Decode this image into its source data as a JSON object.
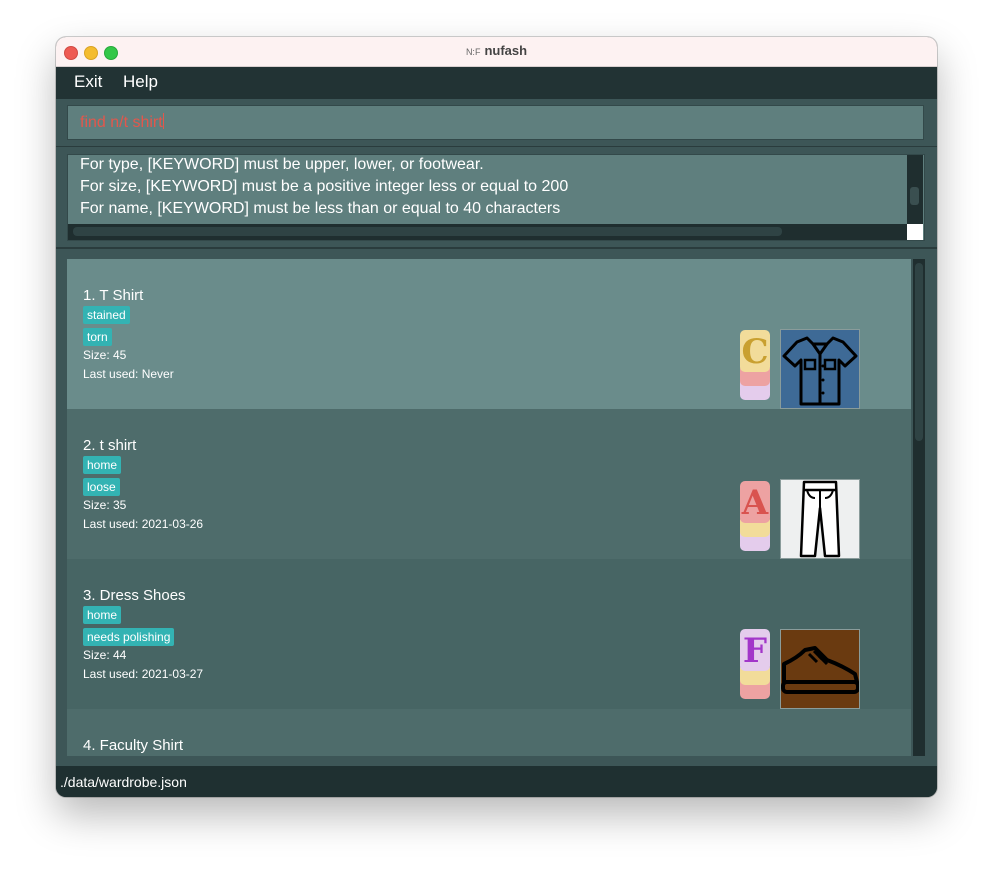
{
  "window": {
    "title": "nufash",
    "app_icon": "N:F"
  },
  "menu": {
    "exit": "Exit",
    "help": "Help"
  },
  "command": {
    "value": "find n/t shirt"
  },
  "result": {
    "lines": [
      "For type, [KEYWORD] must be upper, lower, or footwear.",
      "For size, [KEYWORD] must be a positive integer less or equal to 200",
      "For name, [KEYWORD] must be less than or equal to 40 characters"
    ]
  },
  "garments": [
    {
      "name": "1.  T Shirt",
      "tags": [
        "stained",
        "torn"
      ],
      "size": "Size: 45",
      "last_used": "Last used: Never",
      "dress_code": "C",
      "thumbnail_icon": "shirt-icon",
      "thumb_bg": "#3e6a96"
    },
    {
      "name": "2.  t shirt",
      "tags": [
        "home",
        "loose"
      ],
      "size": "Size: 35",
      "last_used": "Last used: 2021-03-26",
      "dress_code": "A",
      "thumbnail_icon": "pants-icon",
      "thumb_bg": "#eef0f0"
    },
    {
      "name": "3.  Dress Shoes",
      "tags": [
        "home",
        "needs polishing"
      ],
      "size": "Size: 44",
      "last_used": "Last used: 2021-03-27",
      "dress_code": "F",
      "thumbnail_icon": "shoe-icon",
      "thumb_bg": "#6a3a10"
    },
    {
      "name": "4.  Faculty Shirt"
    }
  ],
  "status": {
    "path": "./data/wardrobe.json"
  },
  "colors": {
    "command_text": "#e2574c",
    "tag_bg": "#33b3b3",
    "card_selected": "#6a8c8b",
    "card_odd": "#4e6c6b",
    "card_even": "#476564",
    "dress_yellow": "#f2dc9a",
    "dress_pink": "#eda2a2",
    "dress_lilac": "#e4ccec"
  }
}
